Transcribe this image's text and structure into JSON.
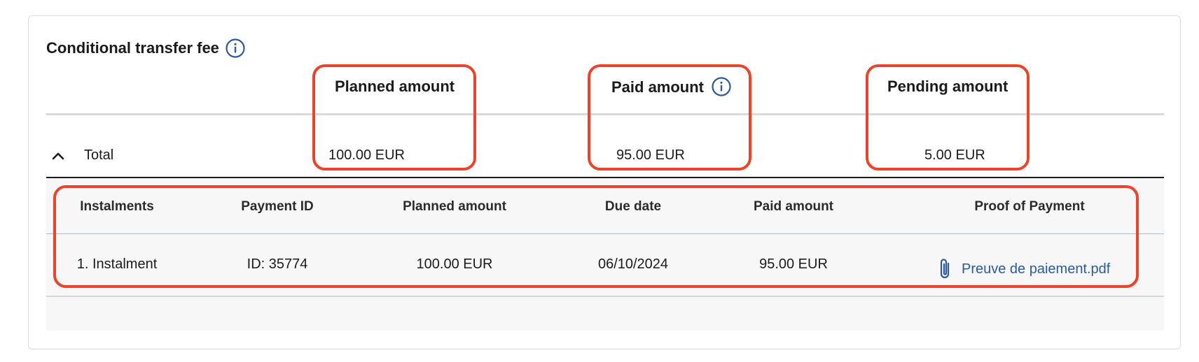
{
  "section": {
    "title": "Conditional transfer fee",
    "title_icon": "info-icon"
  },
  "summary": {
    "columns": {
      "planned": "Planned amount",
      "paid": "Paid amount",
      "paid_icon": "info-icon",
      "pending": "Pending amount"
    },
    "total_row": {
      "toggle_icon": "chevron-up-icon",
      "label": "Total",
      "planned": "100.00 EUR",
      "paid": "95.00 EUR",
      "pending": "5.00 EUR"
    }
  },
  "instalments": {
    "headers": {
      "instalments": "Instalments",
      "payment_id": "Payment ID",
      "planned_amount": "Planned amount",
      "due_date": "Due date",
      "paid_amount": "Paid amount",
      "proof_of_payment": "Proof of Payment"
    },
    "rows": [
      {
        "instalment": "1. Instalment",
        "payment_id": "ID: 35774",
        "planned_amount": "100.00 EUR",
        "due_date": "06/10/2024",
        "paid_amount": "95.00 EUR",
        "proof_file": "Preuve de paiement.pdf",
        "proof_icon": "paperclip-icon"
      }
    ]
  },
  "colors": {
    "highlight": "#e8452c",
    "link": "#2c5a9c",
    "icon": "#2c5a9c"
  }
}
